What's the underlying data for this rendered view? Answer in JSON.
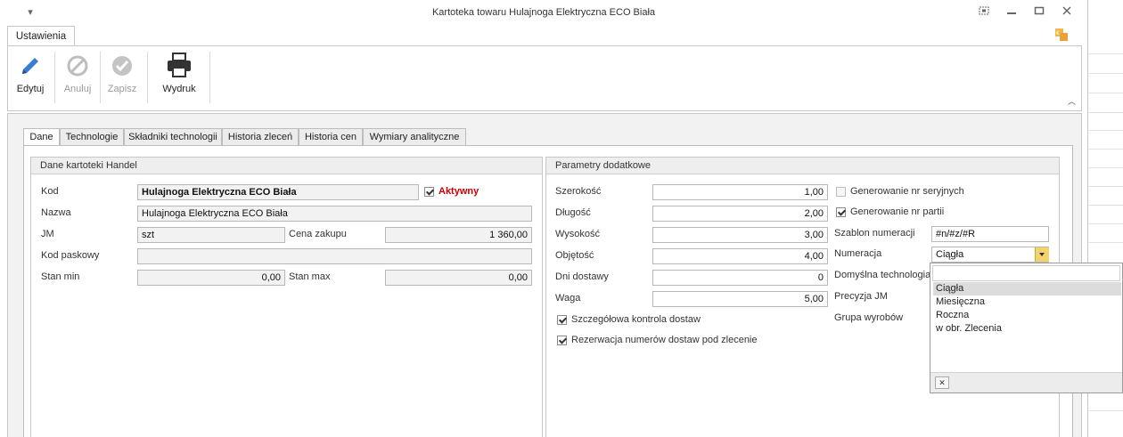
{
  "window": {
    "title": "Kartoteka towaru Hulajnoga Elektryczna ECO Biała",
    "menu_glyph": "▾"
  },
  "ribbon": {
    "tab_label": "Ustawienia",
    "buttons": {
      "edit": "Edytuj",
      "cancel": "Anuluj",
      "save": "Zapisz",
      "print": "Wydruk"
    }
  },
  "tabs": [
    "Dane",
    "Technologie",
    "Składniki technologii",
    "Historia zleceń",
    "Historia cen",
    "Wymiary analityczne"
  ],
  "left_group": {
    "title": "Dane kartoteki Handel",
    "kod_label": "Kod",
    "kod_value": "Hulajnoga Elektryczna ECO Biała",
    "aktywny_label": "Aktywny",
    "aktywny_checked": true,
    "nazwa_label": "Nazwa",
    "nazwa_value": "Hulajnoga Elektryczna ECO Biała",
    "jm_label": "JM",
    "jm_value": "szt",
    "cena_label": "Cena zakupu",
    "cena_value": "1 360,00",
    "kod_paskowy_label": "Kod paskowy",
    "kod_paskowy_value": "",
    "stan_min_label": "Stan min",
    "stan_min_value": "0,00",
    "stan_max_label": "Stan max",
    "stan_max_value": "0,00"
  },
  "right_group": {
    "title": "Parametry dodatkowe",
    "szerokosc_label": "Szerokość",
    "szerokosc_value": "1,00",
    "dlugosc_label": "Długość",
    "dlugosc_value": "2,00",
    "wysokosc_label": "Wysokość",
    "wysokosc_value": "3,00",
    "objetosc_label": "Objętość",
    "objetosc_value": "4,00",
    "dni_label": "Dni dostawy",
    "dni_value": "0",
    "waga_label": "Waga",
    "waga_value": "5,00",
    "szczegolowa_label": "Szczegółowa kontrola dostaw",
    "szczegolowa_checked": true,
    "rezerwacja_label": "Rezerwacja numerów dostaw pod zlecenie",
    "rezerwacja_checked": true,
    "gen_seryjnych_label": "Generowanie nr seryjnych",
    "gen_seryjnych_checked": false,
    "gen_partii_label": "Generowanie nr partii",
    "gen_partii_checked": true,
    "szablon_label": "Szablon numeracji",
    "szablon_value": "#n/#z/#R",
    "numeracja_label": "Numeracja",
    "numeracja_value": "Ciągła",
    "technologia_label": "Domyślna technologia",
    "precyzja_label": "Precyzja JM",
    "grupa_label": "Grupa wyrobów"
  },
  "numeracja_dropdown": {
    "options": [
      "Ciągła",
      "Miesięczna",
      "Roczna",
      "w obr. Zlecenia"
    ],
    "selected": "Ciągła"
  }
}
